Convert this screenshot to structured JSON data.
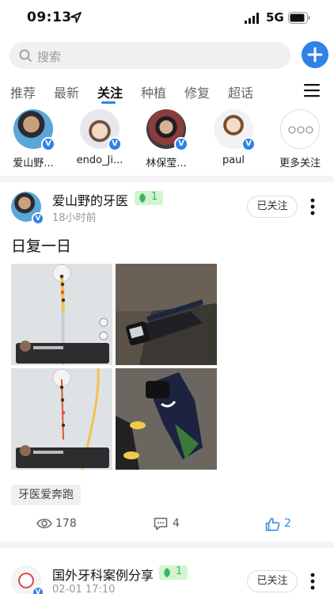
{
  "status_bar": {
    "time": "09:13",
    "network": "5G"
  },
  "search": {
    "placeholder": "搜索"
  },
  "tabs": [
    {
      "label": "推荐"
    },
    {
      "label": "最新"
    },
    {
      "label": "关注",
      "active": true
    },
    {
      "label": "种植"
    },
    {
      "label": "修复"
    },
    {
      "label": "超话"
    }
  ],
  "follows": [
    {
      "name": "爱山野..."
    },
    {
      "name": "endo_Ji..."
    },
    {
      "name": "林保莹..."
    },
    {
      "name": "paul"
    },
    {
      "name": "更多关注"
    }
  ],
  "post1": {
    "author": "爱山野的牙医",
    "level": "1",
    "time": "18小时前",
    "follow_label": "已关注",
    "text": "日复一日",
    "tag": "牙医爱奔跑",
    "views": "178",
    "comments": "4",
    "likes": "2"
  },
  "post2": {
    "author": "国外牙科案例分享",
    "level": "1",
    "time": "02-01 17:10",
    "follow_label": "已关注"
  },
  "colors": {
    "accent": "#2f82e6",
    "level_bg": "#d2f5cf",
    "level_text": "#3ab36a"
  },
  "icons": [
    "location-arrow-icon",
    "signal-icon",
    "battery-icon",
    "search-icon",
    "plus-icon",
    "menu-icon",
    "verified-icon",
    "more-vertical-icon",
    "eye-icon",
    "comment-icon",
    "thumbs-up-icon",
    "leaf-icon"
  ]
}
